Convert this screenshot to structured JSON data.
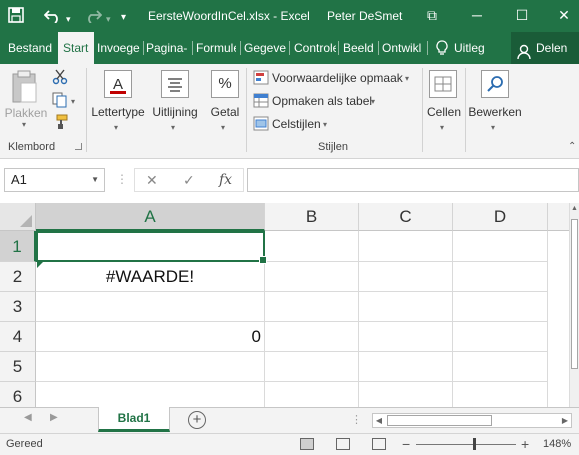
{
  "window": {
    "title": "EersteWoordInCel.xlsx - Excel",
    "user": "Peter DeSmet",
    "controls": {
      "restore": "⧉",
      "minimize": "─",
      "maximize": "☐",
      "close": "✕"
    }
  },
  "quick_access": {
    "save": "save-icon",
    "undo": "undo-icon",
    "redo": "redo-icon",
    "customize": "▾"
  },
  "tabs": [
    "Bestand",
    "Start",
    "Invoege",
    "Pagina-",
    "Formule",
    "Gegeve",
    "Controle",
    "Beeld",
    "Ontwikl"
  ],
  "active_tab": "Start",
  "tell_me": "Uitleg",
  "share": "Delen",
  "ribbon": {
    "clipboard": {
      "paste_label": "Plakken",
      "group_label": "Klembord"
    },
    "font": {
      "label": "Lettertype"
    },
    "alignment": {
      "label": "Uitlijning"
    },
    "number": {
      "label": "Getal"
    },
    "styles": {
      "conditional": "Voorwaardelijke opmaak",
      "format_table": "Opmaken als tabel",
      "cell_styles": "Celstijlen",
      "group_label": "Stijlen"
    },
    "cells": {
      "label": "Cellen"
    },
    "editing": {
      "label": "Bewerken"
    }
  },
  "formula_bar": {
    "name_box": "A1",
    "fx": "fx",
    "value": ""
  },
  "columns": [
    "A",
    "B",
    "C",
    "D"
  ],
  "rows": [
    "1",
    "2",
    "3",
    "4",
    "5",
    "6"
  ],
  "cells": {
    "A2": "#WAARDE!",
    "A4": "0"
  },
  "selected_cell": "A1",
  "sheets": [
    "Blad1"
  ],
  "status": {
    "text": "Gereed",
    "zoom": "148%",
    "zoom_minus": "−",
    "zoom_plus": "+"
  },
  "colors": {
    "accent": "#217346",
    "accent_dark": "#1a5c38"
  }
}
